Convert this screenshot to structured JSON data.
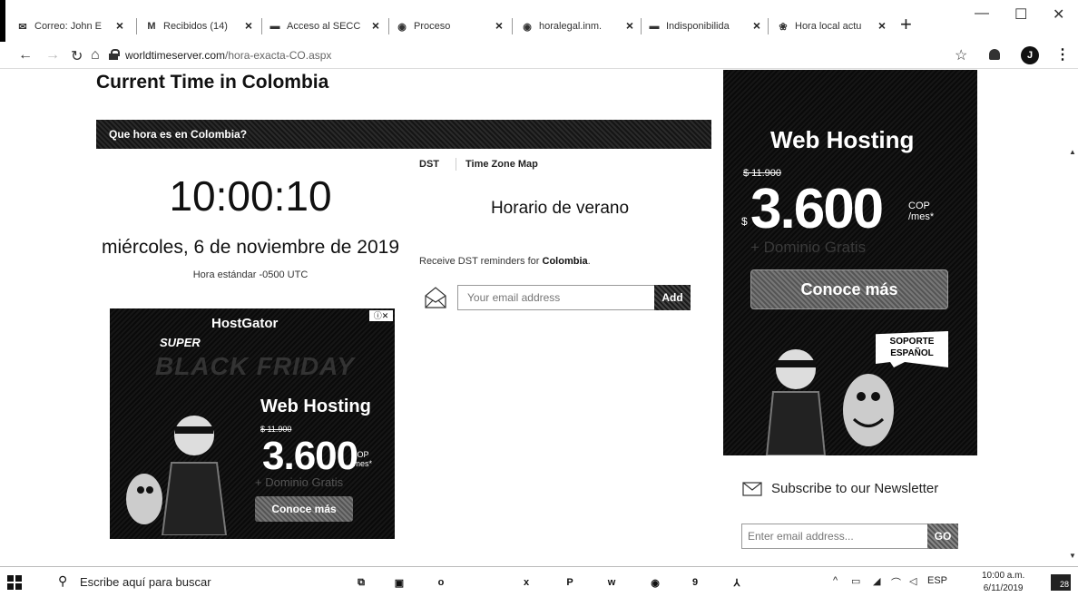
{
  "browser": {
    "tabs": [
      {
        "label": "Correo: John E",
        "icon": "outlook-icon"
      },
      {
        "label": "Recibidos (14)",
        "icon": "gmail-icon"
      },
      {
        "label": "Acceso al SECC",
        "icon": "secop-icon"
      },
      {
        "label": "Proceso",
        "icon": "globe-icon"
      },
      {
        "label": "horalegal.inm.",
        "icon": "globe-icon"
      },
      {
        "label": "Indisponibilida",
        "icon": "secop-icon"
      },
      {
        "label": "Hora local actu",
        "icon": "clock-site-icon"
      }
    ],
    "url_host": "worldtimeserver.com",
    "url_path": "/hora-exacta-CO.aspx",
    "avatar_letter": "J"
  },
  "page": {
    "title": "Current Time in Colombia",
    "section_header": "Que hora es en Colombia?",
    "time": "10:00:10",
    "date": "miércoles, 6 de noviembre de 2019",
    "utc_label": "Hora estándar -0500 UTC",
    "tabs": [
      "DST",
      "Time Zone Map"
    ],
    "dst_status": "Horario de verano",
    "reminder_prefix": "Receive DST reminders for ",
    "reminder_country": "Colombia",
    "reminder_suffix": ".",
    "email_placeholder": "Your email address",
    "add_label": "Add",
    "newsletter_label": "Subscribe to our Newsletter",
    "newsletter_placeholder": "Enter email address...",
    "go_label": "GO"
  },
  "ad_left": {
    "brand": "HostGator",
    "super": "SUPER",
    "black_friday": "BLACK FRIDAY",
    "headline": "Web Hosting",
    "old_price": "$ 11.900",
    "price": "3.600",
    "currency": "COP",
    "per": "/mes*",
    "domain": "+ Dominio Gratis",
    "cta": "Conoce más"
  },
  "ad_right": {
    "headline": "Web Hosting",
    "old_price": "$ 11.900",
    "price": "3.600",
    "currency_sign": "$",
    "currency": "COP",
    "per": "/mes*",
    "domain": "+ Dominio Gratis",
    "cta": "Conoce más",
    "badge": "SOPORTE ESPAÑOL"
  },
  "taskbar": {
    "search_placeholder": "Escribe aquí para buscar",
    "language": "ESP",
    "time": "10:00 a.m.",
    "date": "6/11/2019",
    "notifications": "28"
  }
}
